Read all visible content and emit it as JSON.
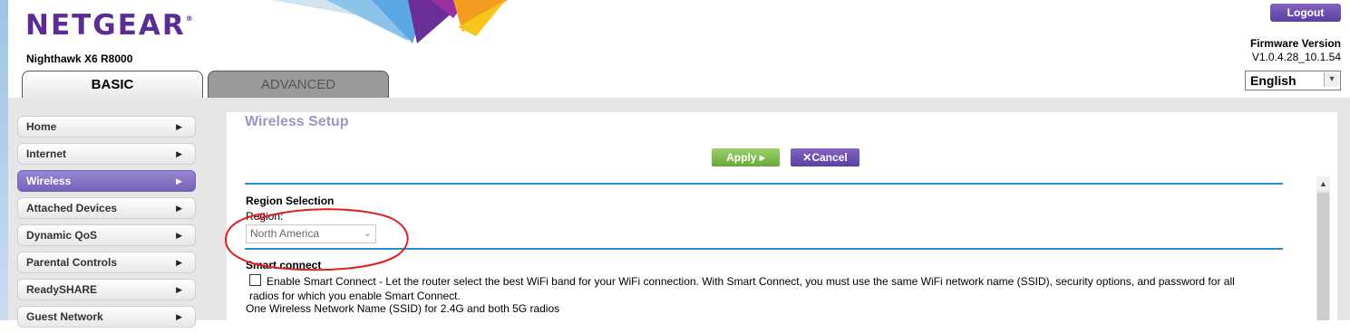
{
  "header": {
    "logo_text": "NETGEAR",
    "logo_mark": "®",
    "model": "Nighthawk X6 R8000",
    "logout_label": "Logout",
    "firmware_label": "Firmware Version",
    "firmware_value": "V1.0.4.28_10.1.54",
    "language": "English"
  },
  "tabs": [
    {
      "label": "BASIC",
      "active": true
    },
    {
      "label": "ADVANCED",
      "active": false
    }
  ],
  "sidebar": {
    "items": [
      {
        "label": "Home"
      },
      {
        "label": "Internet"
      },
      {
        "label": "Wireless",
        "active": true
      },
      {
        "label": "Attached Devices"
      },
      {
        "label": "Dynamic QoS"
      },
      {
        "label": "Parental Controls"
      },
      {
        "label": "ReadySHARE"
      },
      {
        "label": "Guest Network"
      }
    ]
  },
  "main": {
    "title": "Wireless Setup",
    "apply_label": "Apply ▸",
    "cancel_label": "Cancel",
    "region_heading": "Region Selection",
    "region_label": "Region:",
    "region_value": "North America",
    "smart_heading": "Smart connect",
    "smart_checked": false,
    "smart_text": "Enable Smart Connect - Let the router select the best WiFi band for your WiFi connection. With Smart Connect, you must use the same WiFi network name (SSID), security options, and password for all radios for which you enable Smart Connect.",
    "ssid_note": "One Wireless Network Name (SSID) for 2.4G and both 5G radios"
  },
  "colors": {
    "brand_purple": "#5b2c91",
    "apply_green": "#6aa83a",
    "rule_blue": "#2b8ec8",
    "annotation_red": "#e02020"
  }
}
